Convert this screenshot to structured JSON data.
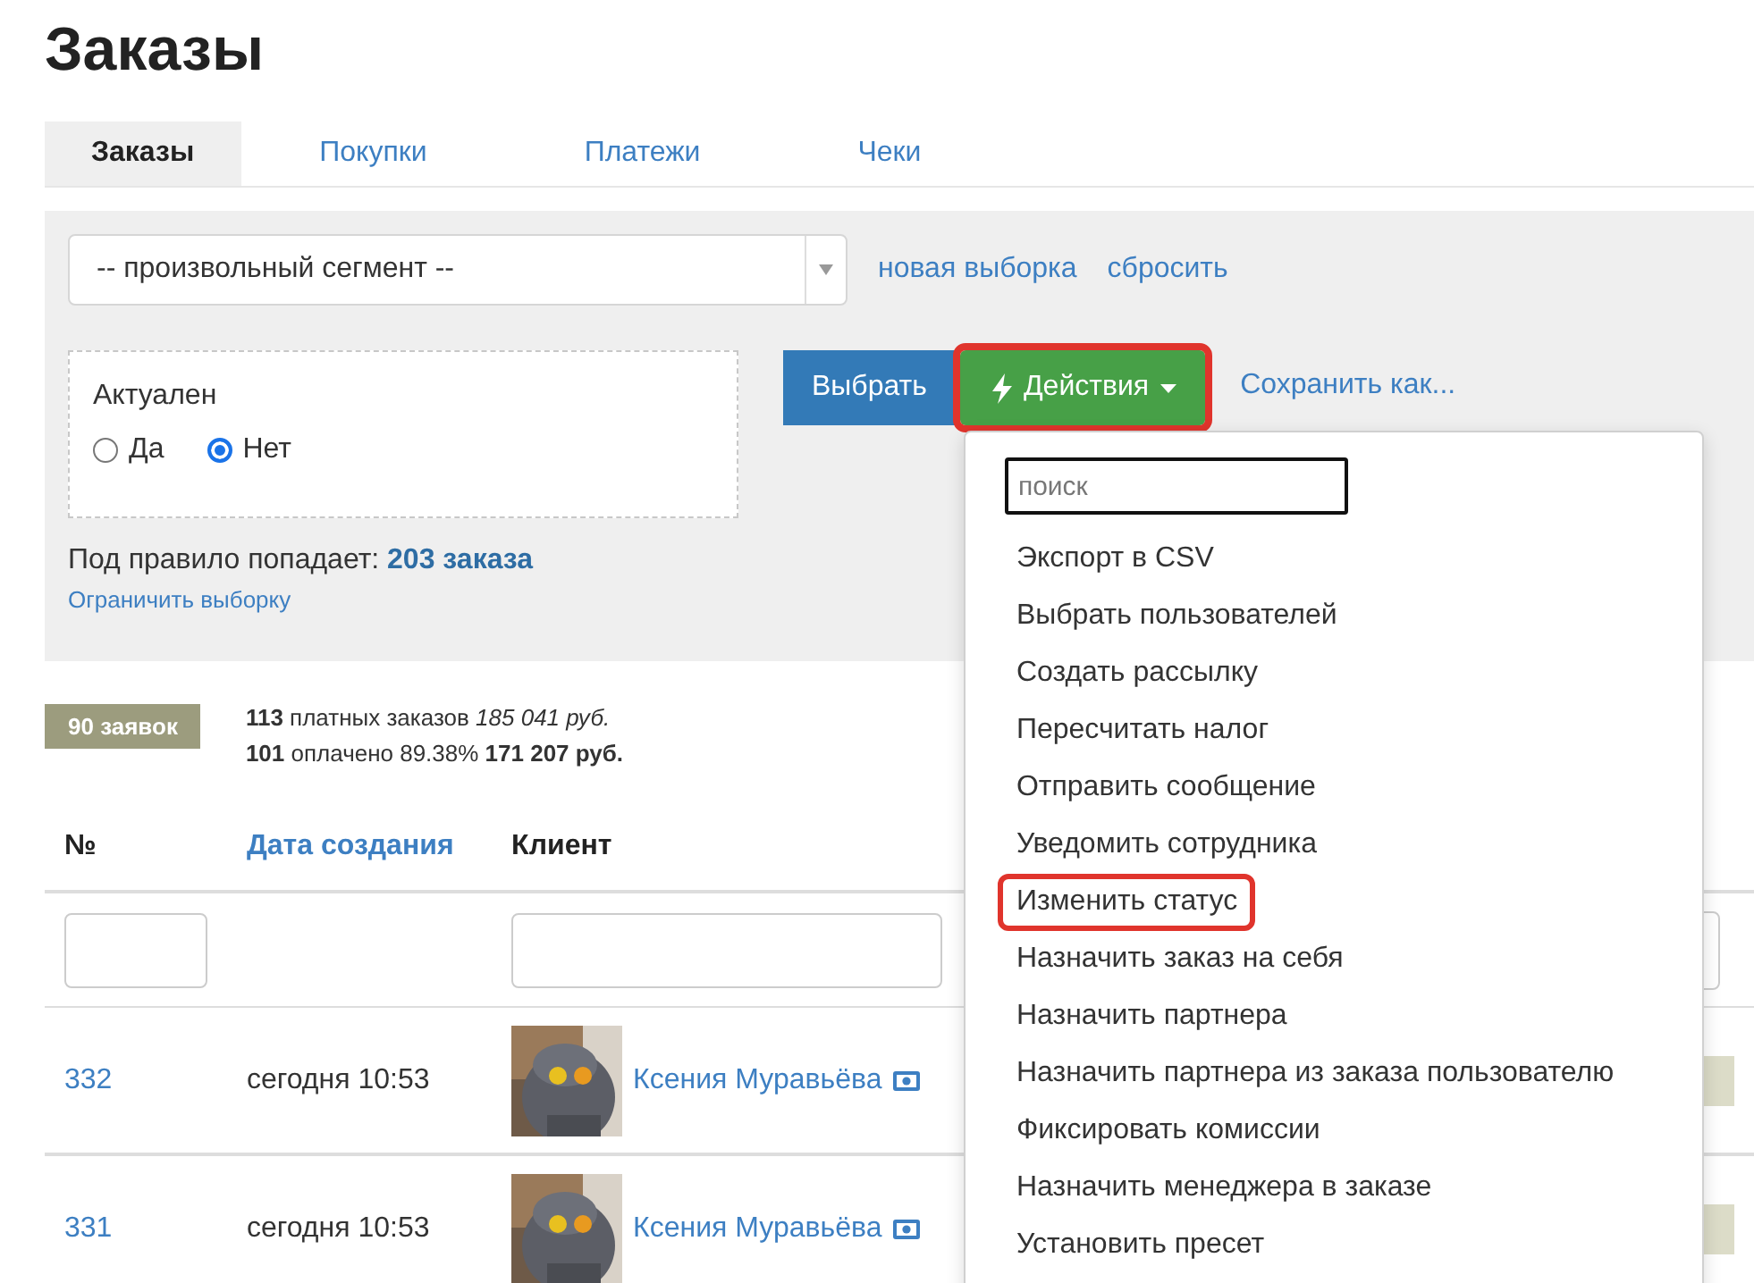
{
  "page_title": "Заказы",
  "tabs": [
    {
      "label": "Заказы",
      "selected": true
    },
    {
      "label": "Покупки",
      "selected": false
    },
    {
      "label": "Платежи",
      "selected": false
    },
    {
      "label": "Чеки",
      "selected": false
    }
  ],
  "filter": {
    "segment_select": {
      "value": "-- произвольный сегмент --"
    },
    "links": [
      "новая выборка",
      "сбросить"
    ],
    "condition": {
      "label": "Актуален",
      "options": [
        {
          "label": "Да",
          "selected": false
        },
        {
          "label": "Нет",
          "selected": true
        }
      ]
    },
    "select_button": "Выбрать",
    "actions_button": {
      "label": "Действия",
      "highlighted": true
    },
    "save_as_link": "Сохранить как...",
    "match_text": "Под правило попадает: **203 заказа**",
    "limit_link": "Ограничить выборку"
  },
  "actions_menu": {
    "search": {
      "placeholder": "поиск"
    },
    "items": [
      {
        "label": "Экспорт в CSV",
        "highlighted": false
      },
      {
        "label": "Выбрать пользователей",
        "highlighted": false
      },
      {
        "label": "Создать рассылку",
        "highlighted": false
      },
      {
        "label": "Пересчитать налог",
        "highlighted": false
      },
      {
        "label": "Отправить сообщение",
        "highlighted": false
      },
      {
        "label": "Уведомить сотрудника",
        "highlighted": false
      },
      {
        "label": "Изменить статус",
        "highlighted": true
      },
      {
        "label": "Назначить заказ на себя",
        "highlighted": false
      },
      {
        "label": "Назначить партнера",
        "highlighted": false
      },
      {
        "label": "Назначить партнера из заказа пользователю",
        "highlighted": false
      },
      {
        "label": "Фиксировать комиссии",
        "highlighted": false
      },
      {
        "label": "Назначить менеджера в заказе",
        "highlighted": false
      },
      {
        "label": "Установить пресет",
        "highlighted": false
      }
    ]
  },
  "summary": {
    "badge": "90 заявок",
    "lines": [
      "**113** платных заказов *185 041 руб.*",
      "**101** оплачено 89.38% **171 207 руб.**"
    ]
  },
  "table": {
    "columns": [
      {
        "label": "№",
        "sortable": false
      },
      {
        "label": "Дата создания",
        "sortable": true
      },
      {
        "label": "Клиент",
        "sortable": false
      }
    ],
    "rows": [
      {
        "number": "332",
        "created": "сегодня 10:53",
        "client": "Ксения Муравьёва"
      },
      {
        "number": "331",
        "created": "сегодня 10:53",
        "client": "Ксения Муравьёва"
      }
    ]
  }
}
